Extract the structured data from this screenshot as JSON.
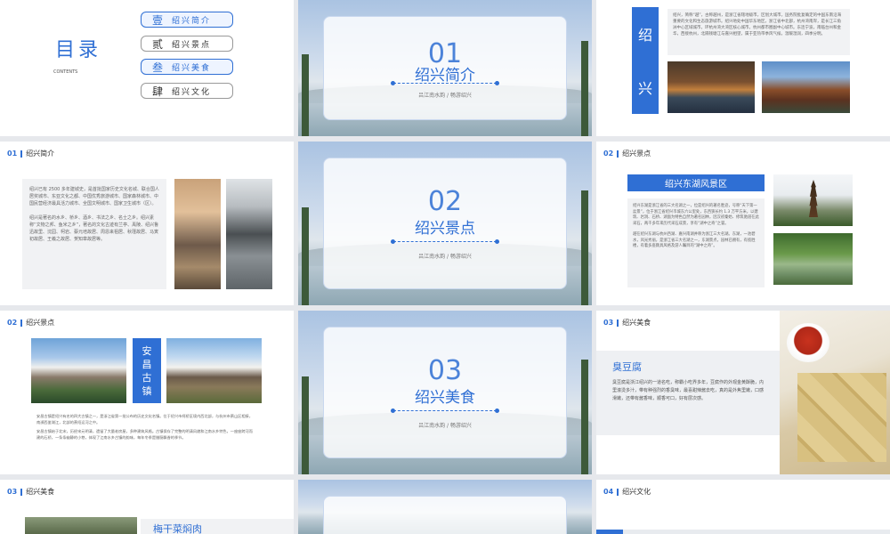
{
  "toc": {
    "title": "目录",
    "contents": "CONTENTS",
    "items": [
      {
        "num": "壹",
        "label": "绍兴简介"
      },
      {
        "num": "贰",
        "label": "绍兴景点"
      },
      {
        "num": "叁",
        "label": "绍兴美食"
      },
      {
        "num": "肆",
        "label": "绍兴文化"
      }
    ]
  },
  "sections": [
    {
      "num": "01",
      "title": "绍兴简介",
      "sub": "吕江南水韵 / 畅游绍兴"
    },
    {
      "num": "02",
      "title": "绍兴景点",
      "sub": "吕江南水韵 / 畅游绍兴"
    },
    {
      "num": "03",
      "title": "绍兴美食",
      "sub": "吕江南水韵 / 畅游绍兴"
    }
  ],
  "shaoxing_slide": {
    "label_a": "绍",
    "label_b": "兴",
    "text": "绍兴，简称“越”，古称越州，是浙江省辖地级市，区划大城市，国务院批复确定的中国东南沿海重要的文化和生态旅游城市。绍兴地处中国华东地区，浙江省中北部，杭州湾南岸，是长江三角洲中心区域城市，环杭州湾大湾区核心城市，杭州都市圈副中心城市。东连宁波，南临台州和金华，西接杭州，北隔钱塘江与嘉兴相望，属于亚热带季风气候，温暖湿润，四季分明。"
  },
  "intro_slide": {
    "num": "01",
    "header": "绍兴简介",
    "para1": "绍兴已有 2500 多年建城史，是首批国家历史文化名城、联合国人居奖城市、东亚文化之都、中国优秀旅游城市、国家森林城市、中国民营经济最具活力城市、全国文明城市、国家卫生城市（区）。",
    "para2": "绍兴是著名的水乡、桥乡、酒乡、书法之乡、名士之乡。绍兴素称“文物之邦、鱼米之乡”，著名的文化古迹有兰亭、禹陵、绍兴鲁迅故里、沈园、柯岩、蔡元培故居、周恩来祖居、秋瑾故居、马寅初故居、王羲之故居、贺知章故居等。"
  },
  "donghu_slide": {
    "num": "02",
    "header": "绍兴景点",
    "banner": "绍兴东湖风景区",
    "para1": "绍兴东湖是浙江省的三大名湖之一，位是绍兴的著名胜迹，号称“天下第一盆景”，位于浙江省绍兴市城东六公里处，东西狭长约 1.3 万平方米，以建筑、岩洞、石桥、湖面为特色自然为著名园林，因汉初秦始、修筑驰道在此采石，两千多年来历代采石成景，享有“湖中之奇”之誉。",
    "para2": "越在绍兴东湖与杭州西湖、嘉兴南湖并称为浙江三大名湖。东湖，一池碧水，风光秀丽，是浙江省三大名湖之一，东湖景点，园林已拥有，有揽胜楼，有着多座颇具风格及游人瞩目的“湖中之奇”。"
  },
  "anchang_slide": {
    "num": "02",
    "header": "绍兴景点",
    "banner": "安昌古镇",
    "para1": "安昌古镇是绍兴有名的四大古镇之一，是浙江省第一批公布的历史文化名镇。位于绍兴市柯桥区境内西北部，与杭州市萧山区相接，南濒西鉴湖江，北部的萧绍运河之中。",
    "para2": "安昌古镇始于北宋，历经宋元明清，遗留了大量老房屋，多种建筑风格。古镇保存了完整的明清风貌和江南水乡特色，一座座跨河而建的石桥，一条条幽静的小巷，体现了江南水乡古镇的韵味，每年冬季是腊肠飘香的季节。"
  },
  "doufu_slide": {
    "num": "03",
    "header": "绍兴美食",
    "title": "臭豆腐",
    "text": "臭豆腐是浙江绍兴的一道名吃，称霸小吃界多年，豆腐作的外观金黄酥脆，内里滚烫多汁，带有种强烈的香臭味，最喜甜辣酱去吃，真的是外焦里嫩，口感滑嫩，还带有酱香味，顺香可口，好有层次感。"
  },
  "meigan_slide": {
    "num": "03",
    "header": "绍兴美食",
    "title": "梅干菜焖肉"
  },
  "culture_slide": {
    "num": "04",
    "header": "绍兴文化"
  }
}
